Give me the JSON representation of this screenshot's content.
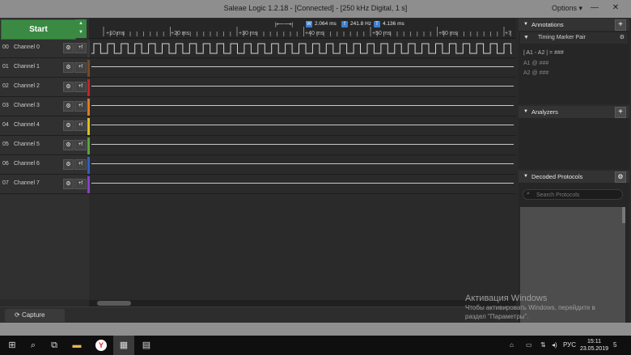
{
  "window": {
    "title": "Saleae Logic 1.2.18 - [Connected] - [250 kHz Digital, 1 s]",
    "options_label": "Options ▾",
    "minimize": "—",
    "close": "✕"
  },
  "start": {
    "label": "Start",
    "arrows": "▲\n▼"
  },
  "ruler": {
    "ticks": [
      "+10 ms",
      "+20 ms",
      "+30 ms",
      "+40 ms",
      "+50 ms",
      "+60 ms",
      "+7"
    ],
    "measurements": {
      "width": {
        "badge": "W",
        "value": "2.064 ms"
      },
      "freq": {
        "badge": "f",
        "value": "241.8 Hz"
      },
      "period": {
        "badge": "T",
        "value": "4.136 ms"
      }
    }
  },
  "channels": [
    {
      "num": "00",
      "name": "Channel 0",
      "color": "#3a3a3a"
    },
    {
      "num": "01",
      "name": "Channel 1",
      "color": "#7a4a1e"
    },
    {
      "num": "02",
      "name": "Channel 2",
      "color": "#c0262c"
    },
    {
      "num": "03",
      "name": "Channel 3",
      "color": "#e07a1a"
    },
    {
      "num": "04",
      "name": "Channel 4",
      "color": "#d8c21c"
    },
    {
      "num": "05",
      "name": "Channel 5",
      "color": "#55a83a"
    },
    {
      "num": "06",
      "name": "Channel 6",
      "color": "#2f5fc7"
    },
    {
      "num": "07",
      "name": "Channel 7",
      "color": "#8a3fc7"
    }
  ],
  "channel_buttons": {
    "gear": "⚙",
    "trigger": "+f"
  },
  "tabs": {
    "capture": "Capture"
  },
  "annotations": {
    "title": "Annotations",
    "add": "+",
    "marker_pair": "Timing Marker Pair",
    "line1": "| A1 - A2 | = ###",
    "line2": "A1  @  ###",
    "line3": "A2  @  ###"
  },
  "analyzers": {
    "title": "Analyzers",
    "add": "+"
  },
  "decoded": {
    "title": "Decoded Protocols",
    "search_placeholder": "Search Protocols"
  },
  "watermark": {
    "line1": "Активация Windows",
    "line2": "Чтобы активировать Windows, перейдите в",
    "line3": "раздел \"Параметры\"."
  },
  "taskbar": {
    "lang": "РУС",
    "time": "15:11",
    "date": "23.05.2019",
    "notif": "5"
  }
}
